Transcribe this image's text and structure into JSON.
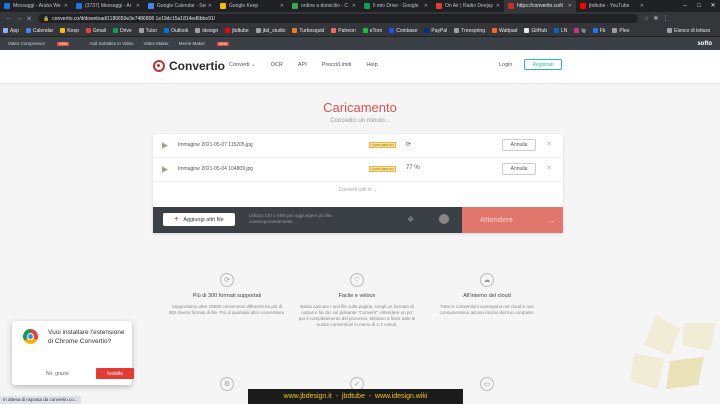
{
  "browser": {
    "tabs": [
      {
        "title": "Messaggi - Aruba We",
        "color": "#1a73e8"
      },
      {
        "title": "(3737) Messaggi - Ar",
        "color": "#1a73e8"
      },
      {
        "title": "Google Calendar - Sett",
        "color": "#4285f4"
      },
      {
        "title": "Google Keep",
        "color": "#fbbc04"
      },
      {
        "title": "ordine a domicilio - C",
        "color": "#34a853"
      },
      {
        "title": "Il mio Drive - Google",
        "color": "#0f9d58"
      },
      {
        "title": "On Air | Radio Deejay",
        "color": "#e53935"
      },
      {
        "title": "https://convertio.co/it",
        "color": "#c9302c"
      },
      {
        "title": "jbdtube - YouTube",
        "color": "#ff0000"
      }
    ],
    "url": "convertio.co/it/download/1186650e3e7486808 1e19dc15a1814ed6bbe91/",
    "bookmarks": [
      {
        "label": "App",
        "color": "#8ab4f8"
      },
      {
        "label": "Calendar",
        "color": "#4285f4"
      },
      {
        "label": "Keep",
        "color": "#fbbc04"
      },
      {
        "label": "Gmail",
        "color": "#ea4335"
      },
      {
        "label": "Drive",
        "color": "#0f9d58"
      },
      {
        "label": "Tutor",
        "color": "#9aa0a6"
      },
      {
        "label": "Outlook",
        "color": "#0078d4"
      },
      {
        "label": "idesign",
        "color": "#9aa0a6"
      },
      {
        "label": "jbdtube",
        "color": "#ff0000"
      },
      {
        "label": "jbd_studio",
        "color": "#9aa0a6"
      },
      {
        "label": "Turbosquid",
        "color": "#e67e22"
      },
      {
        "label": "Patreon",
        "color": "#f96854"
      },
      {
        "label": "eToro",
        "color": "#13c636"
      },
      {
        "label": "Coinbase",
        "color": "#1652f0"
      },
      {
        "label": "PayPal",
        "color": "#003087"
      },
      {
        "label": "Treespring",
        "color": "#9aa0a6"
      },
      {
        "label": "Wattpad",
        "color": "#ff6122"
      },
      {
        "label": "GitHub",
        "color": "#e8eaed"
      },
      {
        "label": "LN",
        "color": "#0a66c2"
      },
      {
        "label": "Ig",
        "color": "#c13584"
      },
      {
        "label": "Fb",
        "color": "#1877f2"
      },
      {
        "label": "Pleo",
        "color": "#9aa0a6"
      }
    ],
    "reading_list": "Elenco di lettura"
  },
  "ext_toolbar": {
    "items": [
      "Video Compressor",
      "Add Subtitles to Video",
      "Video Maker",
      "Meme Maker"
    ],
    "new_badge": "NEW",
    "brand": "softo"
  },
  "site": {
    "logo": "Convertio",
    "nav": [
      "Converti ⌄",
      "OCR",
      "API",
      "Prezzi/Limiti",
      "Help"
    ],
    "login": "Login",
    "signup": "Registrati"
  },
  "upload": {
    "title": "Caricamento",
    "subtitle": "Concedici un minuto...",
    "files": [
      {
        "name": "Immagine 2021-05-07 115205.jpg",
        "badge": "CARICAMENTO",
        "status": "⟳",
        "cancel": "Annulla"
      },
      {
        "name": "Immagine 2021-05-04 104809.jpg",
        "badge": "CARICAMENTO",
        "status": "77 %",
        "cancel": "Annulla"
      }
    ],
    "convert_all": "Converti tutti in ⌄",
    "add_more": "Aggiungi altri file",
    "hint": "Utilizza Ctrl o Shift per aggiungere più file contemporaneamente",
    "convert_button": "Attendere"
  },
  "features": [
    {
      "title": "Più di 300 formati supportati",
      "desc": "Supportiamo oltre 25600 conversioni differenti tra più di 300 diversi formati di file. Più di qualsiasi altro convertitore.",
      "icon": "⟳"
    },
    {
      "title": "Facile e veloce",
      "desc": "Basta caricare i tuoi file sulla pagina, scegli un formato di output e fai clic sul pulsante \"Converti\". Attendere un po' per il completamento del processo. Miriamo a finire tutte le nostre conversioni in meno di 1-2 minuti.",
      "icon": "♡"
    },
    {
      "title": "All'interno del cloud",
      "desc": "Tutte le conversioni avvengono nel cloud e non consumeranno alcuna risorsa del tuo computer.",
      "icon": "☁"
    }
  ],
  "extension_popup": {
    "text": "Vuoi installare l'estensione di Chrome Convertio?",
    "decline": "No, grazie",
    "accept": "Installa"
  },
  "status_bar": "In attesa di risposta da convertio.co...",
  "overlay_text": "www.jbdesign.it  -  jbdtube  -  www.idesign.wiki"
}
